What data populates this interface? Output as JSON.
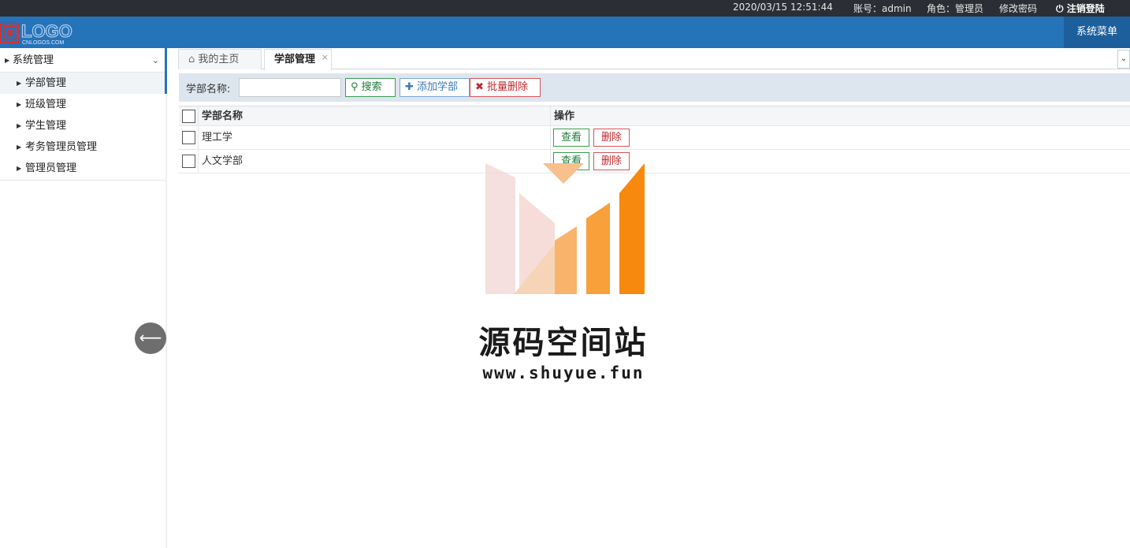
{
  "topbar": {
    "datetime": "2020/03/15 12:51:44",
    "account": "账号：admin",
    "role": "角色：管理员",
    "change_password": "修改密码",
    "logout": "注销登陆"
  },
  "header": {
    "logo_text": "LOGO",
    "logo_subtext": "CNLOGOS.COM",
    "system_menu": "系统菜单"
  },
  "sidebar": {
    "group_label": "系统管理",
    "items": [
      {
        "label": "学部管理",
        "active": true
      },
      {
        "label": "班级管理"
      },
      {
        "label": "学生管理"
      },
      {
        "label": "考务管理员管理"
      },
      {
        "label": "管理员管理"
      }
    ]
  },
  "tabs": [
    {
      "label": "我的主页",
      "icon": "home-icon"
    },
    {
      "label": "学部管理",
      "active": true,
      "closable": true
    }
  ],
  "toolbar": {
    "name_label": "学部名称:",
    "name_value": "",
    "search_label": "搜索",
    "add_label": "添加学部",
    "batch_delete_label": "批量删除"
  },
  "grid": {
    "columns": [
      "学部名称",
      "操作"
    ],
    "rows": [
      {
        "name": "理工学",
        "view": "查看",
        "delete": "删除"
      },
      {
        "name": "人文学部",
        "view": "查看",
        "delete": "删除"
      }
    ]
  },
  "watermark": {
    "title": "源码空间站",
    "url": "www.shuyue.fun"
  },
  "colors": {
    "header": "#2573b8",
    "topbar": "#2b2f35",
    "toolbar": "#dde6ee",
    "green": "#1f7d3a",
    "red": "#c0282d",
    "blue": "#3b79b6",
    "watermark_orange": "#f7890e"
  }
}
